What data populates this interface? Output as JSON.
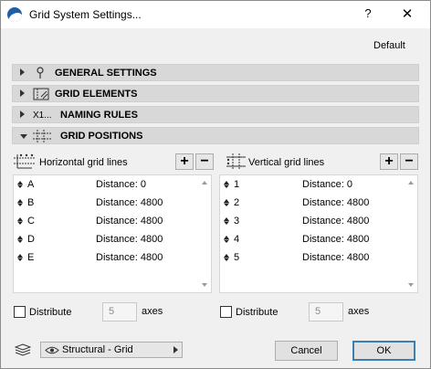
{
  "window": {
    "title": "Grid System Settings...",
    "help_glyph": "?",
    "close_glyph": "✕"
  },
  "favorites_label": "Default",
  "sections": [
    {
      "label": "GENERAL SETTINGS",
      "expanded": false
    },
    {
      "label": "GRID ELEMENTS",
      "expanded": false
    },
    {
      "label": "NAMING RULES",
      "expanded": false,
      "icon_text": "X1..."
    },
    {
      "label": "GRID POSITIONS",
      "expanded": true
    }
  ],
  "horizontal": {
    "title": "Horizontal grid lines",
    "add_glyph": "+",
    "remove_glyph": "−",
    "rows": [
      {
        "name": "A",
        "distance": "Distance: 0"
      },
      {
        "name": "B",
        "distance": "Distance: 4800"
      },
      {
        "name": "C",
        "distance": "Distance: 4800"
      },
      {
        "name": "D",
        "distance": "Distance: 4800"
      },
      {
        "name": "E",
        "distance": "Distance: 4800"
      }
    ],
    "distribute_label": "Distribute",
    "distribute_checked": false,
    "axes_value": "5",
    "axes_label": "axes"
  },
  "vertical": {
    "title": "Vertical grid lines",
    "add_glyph": "+",
    "remove_glyph": "−",
    "rows": [
      {
        "name": "1",
        "distance": "Distance: 0"
      },
      {
        "name": "2",
        "distance": "Distance: 4800"
      },
      {
        "name": "3",
        "distance": "Distance: 4800"
      },
      {
        "name": "4",
        "distance": "Distance: 4800"
      },
      {
        "name": "5",
        "distance": "Distance: 4800"
      }
    ],
    "distribute_label": "Distribute",
    "distribute_checked": false,
    "axes_value": "5",
    "axes_label": "axes"
  },
  "layer_dropdown": {
    "value": "Structural - Grid"
  },
  "buttons": {
    "cancel": "Cancel",
    "ok": "OK"
  },
  "colors": {
    "accent": "#3c7fb1",
    "title_bg": "#ffffff",
    "panel_bg": "#f0f0f0",
    "section_bg": "#d8d8d8"
  }
}
